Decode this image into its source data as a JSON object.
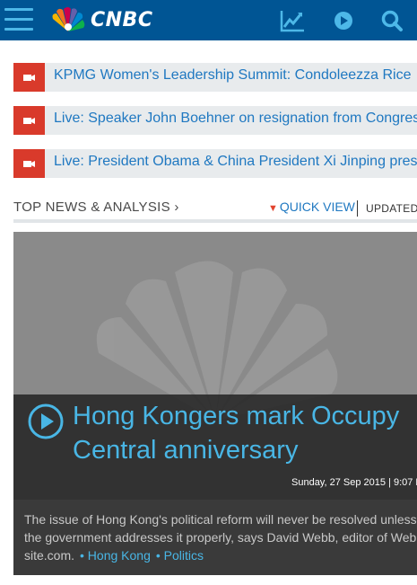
{
  "header": {
    "logo_text": "CNBC",
    "icons": [
      "menu-icon",
      "cnbc-peacock-logo",
      "markets-chart-icon",
      "video-play-icon",
      "search-icon"
    ],
    "colors": {
      "bar": "#005594",
      "accent": "#4db8e8"
    }
  },
  "videos": [
    {
      "title": "KPMG Women's Leadership Summit: Condoleezza Rice"
    },
    {
      "title": "Live: Speaker John Boehner on resignation from Congress"
    },
    {
      "title": "Live: President Obama & China President Xi Jinping press"
    }
  ],
  "section": {
    "title": "TOP NEWS & ANALYSIS ›",
    "quick_view": "QUICK VIEW",
    "updated": "UPDATED:"
  },
  "hero": {
    "title_line1": "Hong Kongers mark Occupy",
    "title_line2": "Central anniversary",
    "date": "Sunday, 27 Sep 2015 | 9:07 PM",
    "description": "The issue of Hong Kong's political reform will never be resolved unless the government addresses it properly, says David Webb, editor of Webb-site.com.",
    "tags": [
      "• Hong Kong",
      "• Politics"
    ]
  }
}
